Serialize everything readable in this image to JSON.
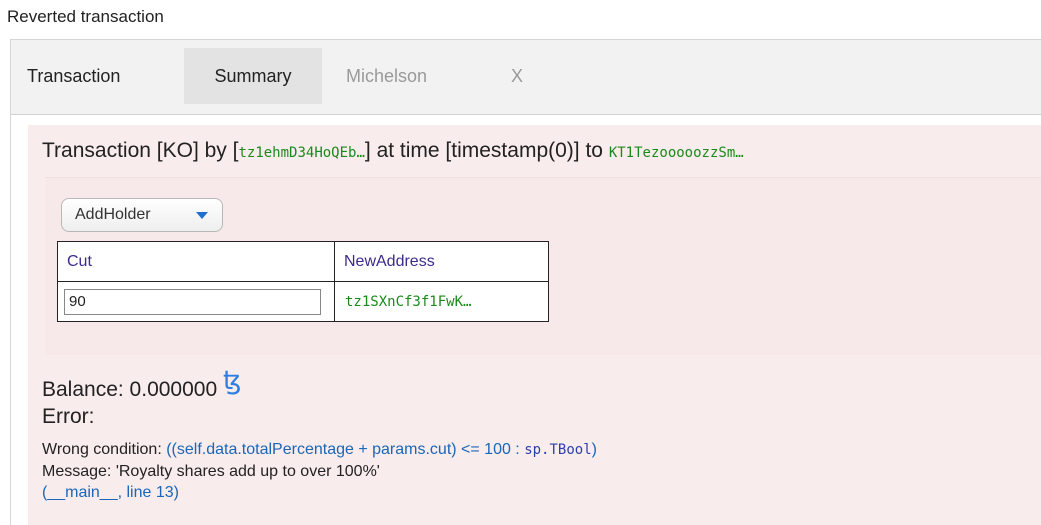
{
  "page": {
    "title": "Reverted transaction"
  },
  "tabs": {
    "transaction": "Transaction",
    "summary": "Summary",
    "michelson": "Michelson",
    "close": "X"
  },
  "summary": {
    "prefix": "Transaction [KO] by [",
    "sender": "tz1ehmD34HoQEb…",
    "mid": "] at time [timestamp(0)] to ",
    "contract": "KT1TezooooozzSm…",
    "entrypoint": "AddHolder",
    "params": {
      "headers": [
        "Cut",
        "NewAddress"
      ],
      "cut_value": "90",
      "new_address": "tz1SXnCf3f1FwK…"
    },
    "balance_label": "Balance: 0.000000",
    "tez_symbol": "ꜩ",
    "error_label": "Error:",
    "error": {
      "condition_prefix": "Wrong condition: ",
      "condition_expr": "((self.data.totalPercentage + params.cut) <= 100 : ",
      "condition_type": "sp.TBool",
      "condition_suffix": ")",
      "message": "Message: 'Royalty shares add up to over 100%'",
      "location": "(__main__, line 13)"
    }
  },
  "colors": {
    "panel_bg": "#f9ecec",
    "address_green": "#1b8a1b",
    "header_purple": "#3d2a8e",
    "link_blue": "#1a66b8",
    "tez_blue": "#2f7fe0"
  }
}
